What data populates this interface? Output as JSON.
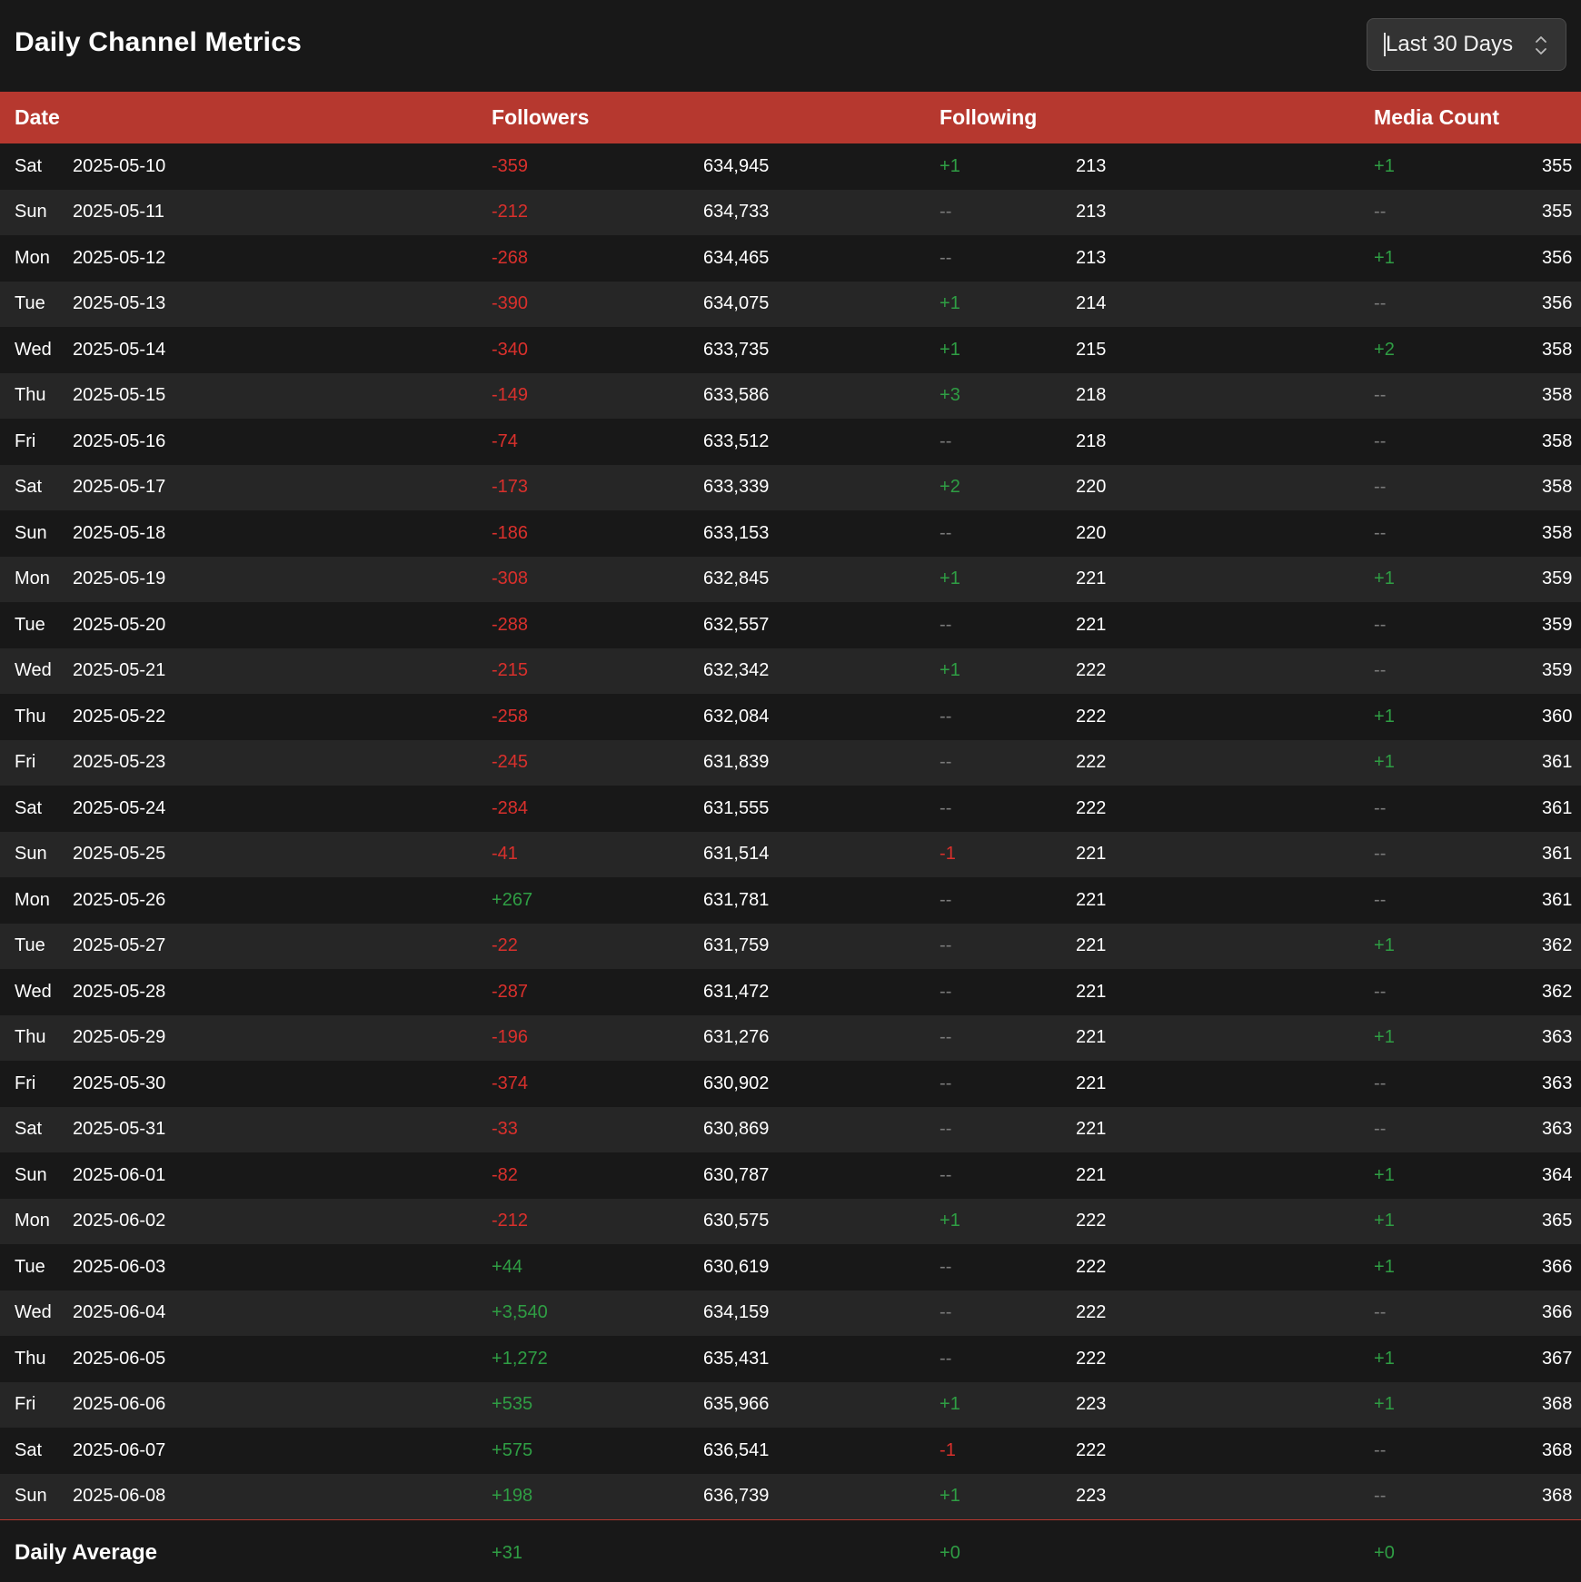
{
  "header": {
    "title": "Daily Channel Metrics",
    "range_selected": "Last 30 Days"
  },
  "table": {
    "columns": [
      "Date",
      "Followers",
      "Following",
      "Media Count"
    ],
    "rows": [
      {
        "day": "Sat",
        "date": "2025-05-10",
        "followers_delta": "-359",
        "followers": "634,945",
        "following_delta": "+1",
        "following": "213",
        "media_delta": "+1",
        "media": "355"
      },
      {
        "day": "Sun",
        "date": "2025-05-11",
        "followers_delta": "-212",
        "followers": "634,733",
        "following_delta": "--",
        "following": "213",
        "media_delta": "--",
        "media": "355"
      },
      {
        "day": "Mon",
        "date": "2025-05-12",
        "followers_delta": "-268",
        "followers": "634,465",
        "following_delta": "--",
        "following": "213",
        "media_delta": "+1",
        "media": "356"
      },
      {
        "day": "Tue",
        "date": "2025-05-13",
        "followers_delta": "-390",
        "followers": "634,075",
        "following_delta": "+1",
        "following": "214",
        "media_delta": "--",
        "media": "356"
      },
      {
        "day": "Wed",
        "date": "2025-05-14",
        "followers_delta": "-340",
        "followers": "633,735",
        "following_delta": "+1",
        "following": "215",
        "media_delta": "+2",
        "media": "358"
      },
      {
        "day": "Thu",
        "date": "2025-05-15",
        "followers_delta": "-149",
        "followers": "633,586",
        "following_delta": "+3",
        "following": "218",
        "media_delta": "--",
        "media": "358"
      },
      {
        "day": "Fri",
        "date": "2025-05-16",
        "followers_delta": "-74",
        "followers": "633,512",
        "following_delta": "--",
        "following": "218",
        "media_delta": "--",
        "media": "358"
      },
      {
        "day": "Sat",
        "date": "2025-05-17",
        "followers_delta": "-173",
        "followers": "633,339",
        "following_delta": "+2",
        "following": "220",
        "media_delta": "--",
        "media": "358"
      },
      {
        "day": "Sun",
        "date": "2025-05-18",
        "followers_delta": "-186",
        "followers": "633,153",
        "following_delta": "--",
        "following": "220",
        "media_delta": "--",
        "media": "358"
      },
      {
        "day": "Mon",
        "date": "2025-05-19",
        "followers_delta": "-308",
        "followers": "632,845",
        "following_delta": "+1",
        "following": "221",
        "media_delta": "+1",
        "media": "359"
      },
      {
        "day": "Tue",
        "date": "2025-05-20",
        "followers_delta": "-288",
        "followers": "632,557",
        "following_delta": "--",
        "following": "221",
        "media_delta": "--",
        "media": "359"
      },
      {
        "day": "Wed",
        "date": "2025-05-21",
        "followers_delta": "-215",
        "followers": "632,342",
        "following_delta": "+1",
        "following": "222",
        "media_delta": "--",
        "media": "359"
      },
      {
        "day": "Thu",
        "date": "2025-05-22",
        "followers_delta": "-258",
        "followers": "632,084",
        "following_delta": "--",
        "following": "222",
        "media_delta": "+1",
        "media": "360"
      },
      {
        "day": "Fri",
        "date": "2025-05-23",
        "followers_delta": "-245",
        "followers": "631,839",
        "following_delta": "--",
        "following": "222",
        "media_delta": "+1",
        "media": "361"
      },
      {
        "day": "Sat",
        "date": "2025-05-24",
        "followers_delta": "-284",
        "followers": "631,555",
        "following_delta": "--",
        "following": "222",
        "media_delta": "--",
        "media": "361"
      },
      {
        "day": "Sun",
        "date": "2025-05-25",
        "followers_delta": "-41",
        "followers": "631,514",
        "following_delta": "-1",
        "following": "221",
        "media_delta": "--",
        "media": "361"
      },
      {
        "day": "Mon",
        "date": "2025-05-26",
        "followers_delta": "+267",
        "followers": "631,781",
        "following_delta": "--",
        "following": "221",
        "media_delta": "--",
        "media": "361"
      },
      {
        "day": "Tue",
        "date": "2025-05-27",
        "followers_delta": "-22",
        "followers": "631,759",
        "following_delta": "--",
        "following": "221",
        "media_delta": "+1",
        "media": "362"
      },
      {
        "day": "Wed",
        "date": "2025-05-28",
        "followers_delta": "-287",
        "followers": "631,472",
        "following_delta": "--",
        "following": "221",
        "media_delta": "--",
        "media": "362"
      },
      {
        "day": "Thu",
        "date": "2025-05-29",
        "followers_delta": "-196",
        "followers": "631,276",
        "following_delta": "--",
        "following": "221",
        "media_delta": "+1",
        "media": "363"
      },
      {
        "day": "Fri",
        "date": "2025-05-30",
        "followers_delta": "-374",
        "followers": "630,902",
        "following_delta": "--",
        "following": "221",
        "media_delta": "--",
        "media": "363"
      },
      {
        "day": "Sat",
        "date": "2025-05-31",
        "followers_delta": "-33",
        "followers": "630,869",
        "following_delta": "--",
        "following": "221",
        "media_delta": "--",
        "media": "363"
      },
      {
        "day": "Sun",
        "date": "2025-06-01",
        "followers_delta": "-82",
        "followers": "630,787",
        "following_delta": "--",
        "following": "221",
        "media_delta": "+1",
        "media": "364"
      },
      {
        "day": "Mon",
        "date": "2025-06-02",
        "followers_delta": "-212",
        "followers": "630,575",
        "following_delta": "+1",
        "following": "222",
        "media_delta": "+1",
        "media": "365"
      },
      {
        "day": "Tue",
        "date": "2025-06-03",
        "followers_delta": "+44",
        "followers": "630,619",
        "following_delta": "--",
        "following": "222",
        "media_delta": "+1",
        "media": "366"
      },
      {
        "day": "Wed",
        "date": "2025-06-04",
        "followers_delta": "+3,540",
        "followers": "634,159",
        "following_delta": "--",
        "following": "222",
        "media_delta": "--",
        "media": "366"
      },
      {
        "day": "Thu",
        "date": "2025-06-05",
        "followers_delta": "+1,272",
        "followers": "635,431",
        "following_delta": "--",
        "following": "222",
        "media_delta": "+1",
        "media": "367"
      },
      {
        "day": "Fri",
        "date": "2025-06-06",
        "followers_delta": "+535",
        "followers": "635,966",
        "following_delta": "+1",
        "following": "223",
        "media_delta": "+1",
        "media": "368"
      },
      {
        "day": "Sat",
        "date": "2025-06-07",
        "followers_delta": "+575",
        "followers": "636,541",
        "following_delta": "-1",
        "following": "222",
        "media_delta": "--",
        "media": "368"
      },
      {
        "day": "Sun",
        "date": "2025-06-08",
        "followers_delta": "+198",
        "followers": "636,739",
        "following_delta": "+1",
        "following": "223",
        "media_delta": "--",
        "media": "368"
      }
    ],
    "footer": {
      "label": "Daily Average",
      "followers_avg": "+31",
      "following_avg": "+0",
      "media_avg": "+0"
    }
  },
  "colors": {
    "header_bg": "#b6382f",
    "negative": "#d9302c",
    "positive": "#2f9e44",
    "neutral": "#7a7a7a"
  }
}
